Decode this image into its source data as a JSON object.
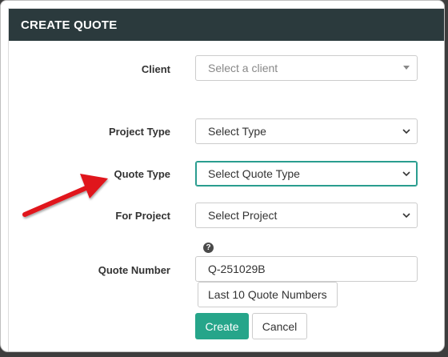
{
  "modal": {
    "title": "CREATE QUOTE"
  },
  "form": {
    "client": {
      "label": "Client",
      "placeholder": "Select a client"
    },
    "project_type": {
      "label": "Project Type",
      "value": "Select Type"
    },
    "quote_type": {
      "label": "Quote Type",
      "value": "Select Quote Type"
    },
    "for_project": {
      "label": "For Project",
      "value": "Select Project"
    },
    "help_icon": "?",
    "quote_number": {
      "label": "Quote Number",
      "value": "Q-251029B"
    },
    "last_numbers_button": "Last 10 Quote Numbers",
    "create_button": "Create",
    "cancel_button": "Cancel"
  },
  "colors": {
    "header_bg": "#2b3a3d",
    "accent": "#26a58a",
    "annotation_arrow": "#e0121c"
  }
}
